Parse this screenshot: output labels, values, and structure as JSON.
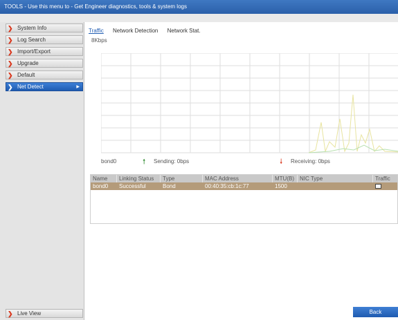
{
  "title_bar": "TOOLS - Use this menu to - Get Engineer diagnostics, tools & system logs",
  "sidebar": {
    "items": [
      {
        "label": "System Info"
      },
      {
        "label": "Log Search"
      },
      {
        "label": "Import/Export"
      },
      {
        "label": "Upgrade"
      },
      {
        "label": "Default"
      },
      {
        "label": "Net Detect",
        "active": true
      }
    ],
    "live_view": "Live View"
  },
  "tabs": [
    {
      "label": "Traffic",
      "active": true
    },
    {
      "label": "Network Detection"
    },
    {
      "label": "Network Stat."
    }
  ],
  "graph": {
    "unit": "8Kbps",
    "interface": "bond0",
    "sending": "Sending: 0bps",
    "receiving": "Receiving: 0bps",
    "sending_color": "#2d8a2d",
    "receiving_color": "#d9381e"
  },
  "table": {
    "headers": [
      "Name",
      "Linking Status",
      "Type",
      "MAC Address",
      "MTU(B)",
      "NIC Type",
      "Traffic"
    ],
    "rows": [
      [
        "bond0",
        "Successful",
        "Bond",
        "00:40:35:cb:1c:77",
        "1500",
        "",
        ""
      ]
    ]
  },
  "back_button": "Back",
  "colors": {
    "accent": "#1f5cb2",
    "selected_row": "#b49b7a",
    "nav_arrow": "#d9381e"
  }
}
